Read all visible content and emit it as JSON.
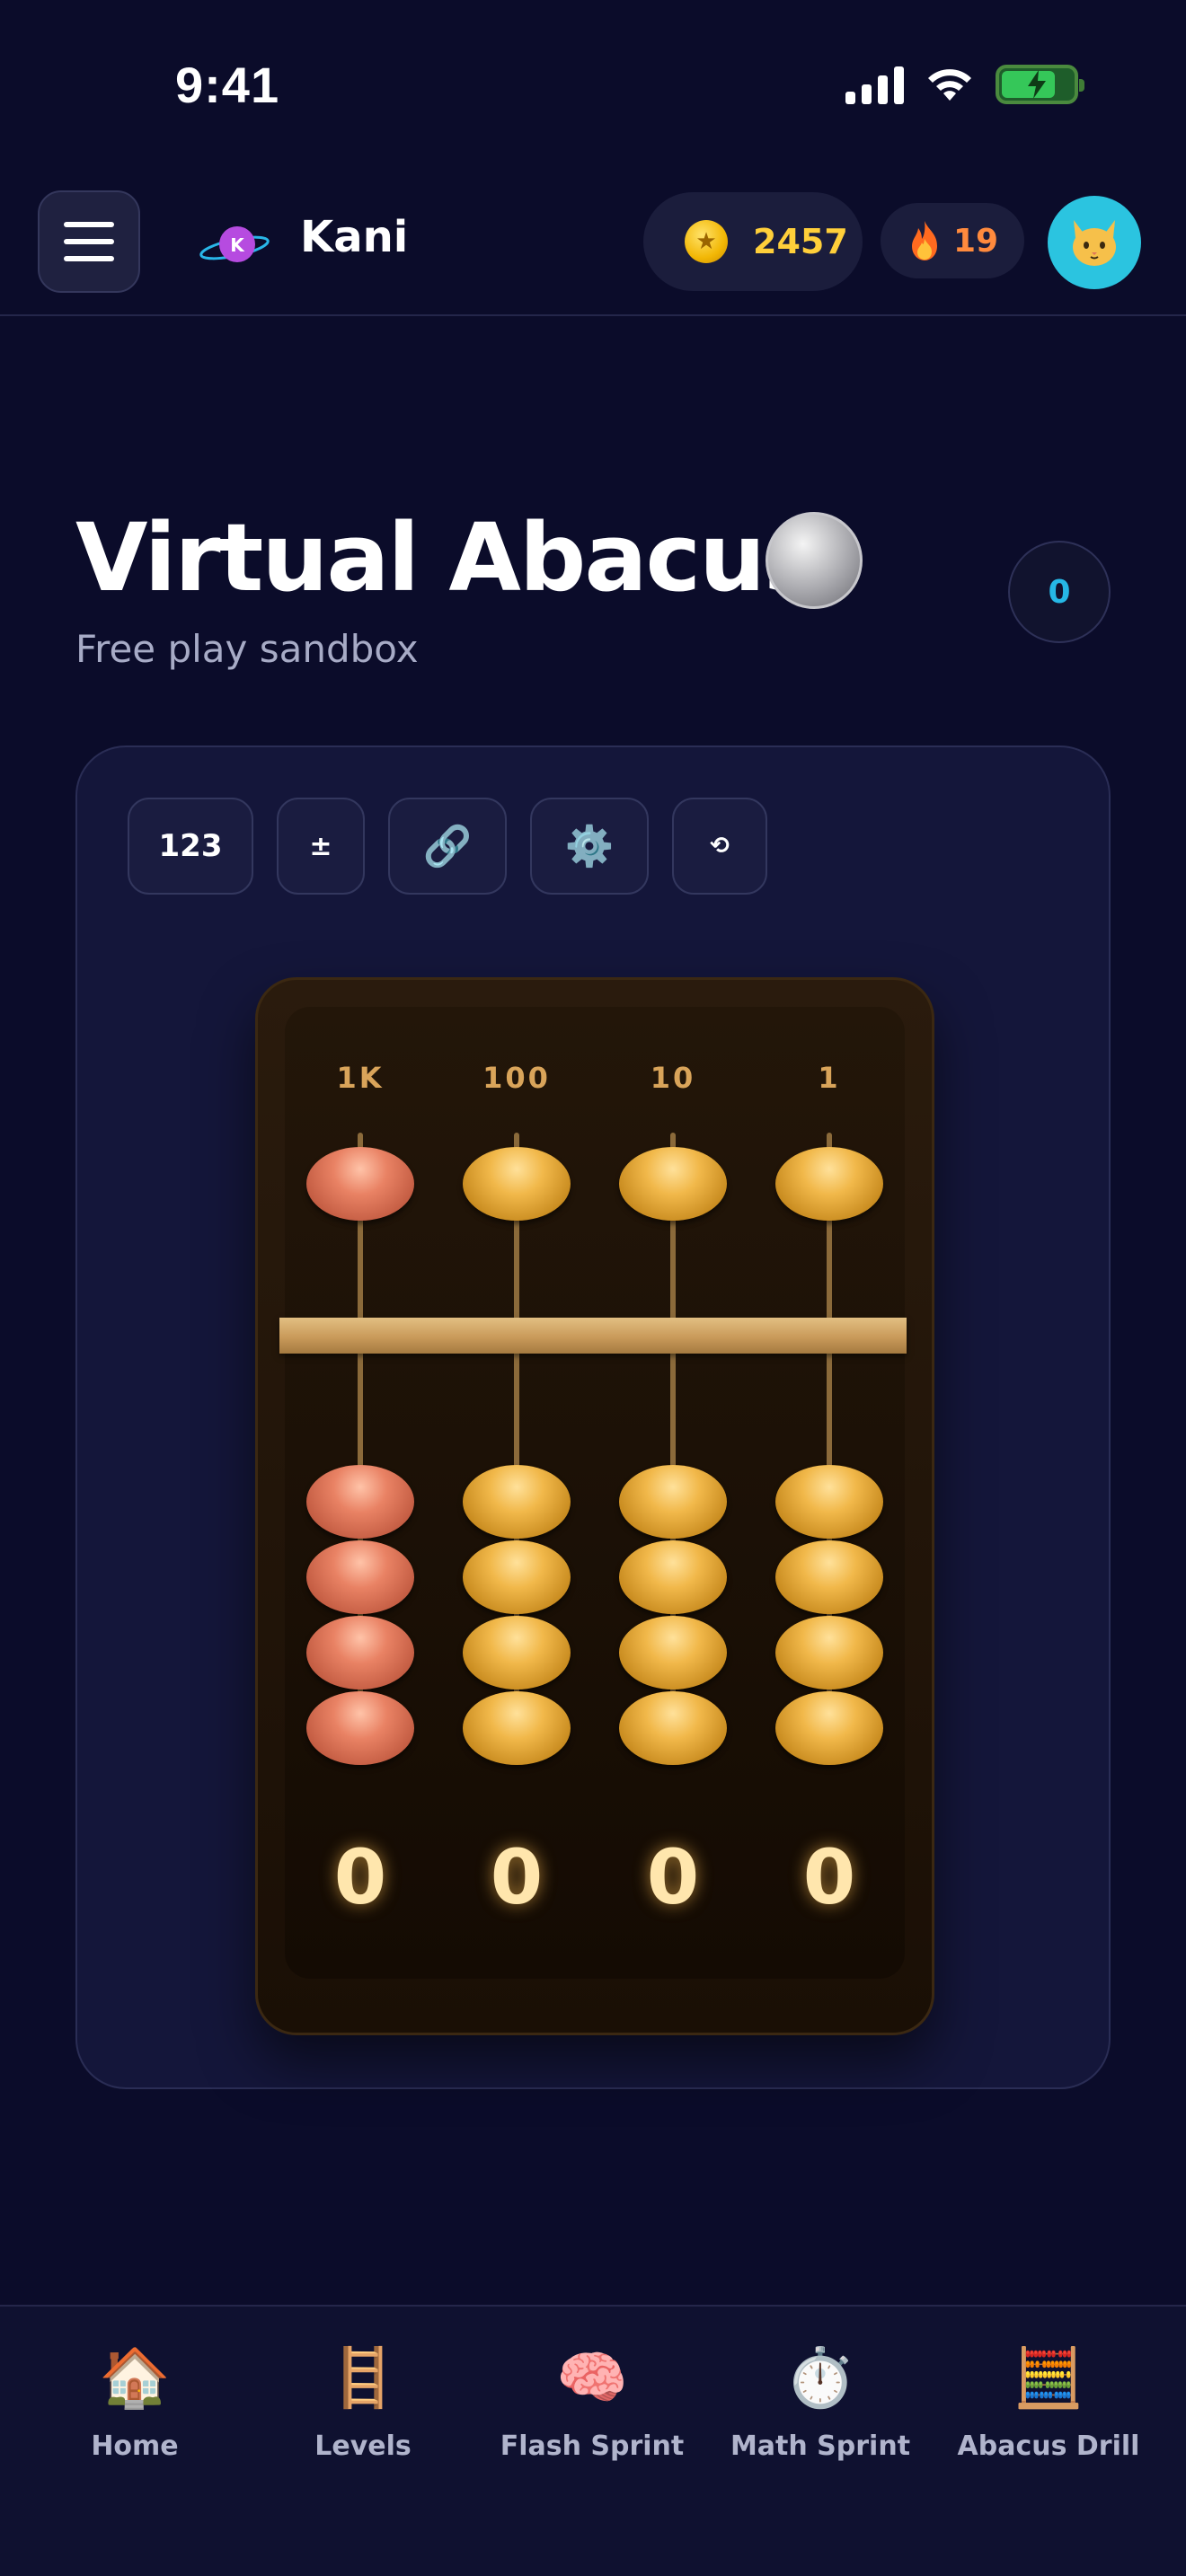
{
  "status_bar": {
    "time": "9:41"
  },
  "header": {
    "brand": "Kani",
    "logo_letter": "K",
    "coins": "2457",
    "streak": "19"
  },
  "title_section": {
    "title": "Virtual Abacus",
    "subtitle": "Free play sandbox",
    "score": "0"
  },
  "toolbar": {
    "numbers_label": "123",
    "plus_minus_label": "±",
    "link_icon": "🔗",
    "settings_icon": "⚙️",
    "reset_icon": "⟲"
  },
  "abacus": {
    "columns": [
      {
        "label": "1K",
        "value": "0",
        "bead_color": "red"
      },
      {
        "label": "100",
        "value": "0",
        "bead_color": "gold"
      },
      {
        "label": "10",
        "value": "0",
        "bead_color": "gold"
      },
      {
        "label": "1",
        "value": "0",
        "bead_color": "gold"
      }
    ],
    "colors": {
      "gold": "#f1b84a",
      "red": "#e07a5f",
      "beam": "#d8b072"
    }
  },
  "nav": [
    {
      "label": "Home",
      "icon": "🏠"
    },
    {
      "label": "Levels",
      "icon": "🪜"
    },
    {
      "label": "Flash Sprint",
      "icon": "🧠"
    },
    {
      "label": "Math Sprint",
      "icon": "⏱️"
    },
    {
      "label": "Abacus Drill",
      "icon": "🧮"
    }
  ]
}
